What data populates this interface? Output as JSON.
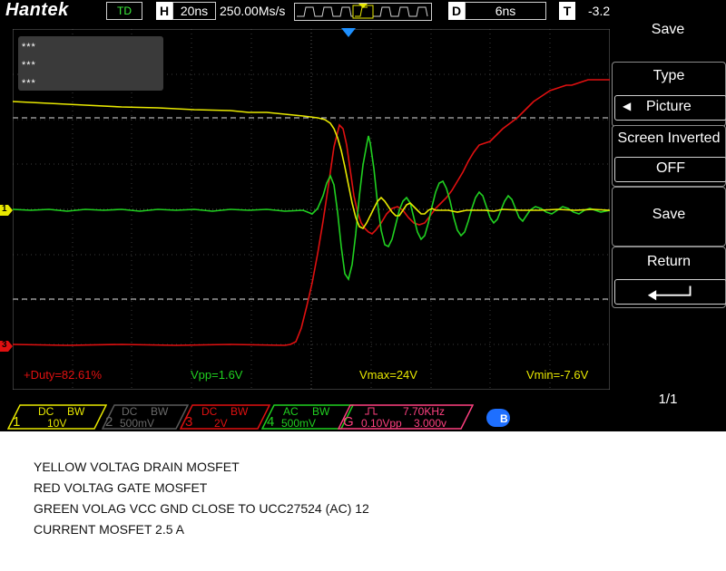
{
  "topbar": {
    "brand": "Hantek",
    "mode": "TD",
    "h_key": "H",
    "h_value": "20ns",
    "sample_rate": "250.00Ms/s",
    "d_key": "D",
    "d_value": "6ns",
    "t_key": "T",
    "t_value": "-3.2"
  },
  "info_box": [
    "***",
    "***",
    "***"
  ],
  "markers": {
    "ch1": "1",
    "ch3": "3"
  },
  "measurements": {
    "duty": "+Duty=82.61%",
    "vpp": "Vpp=1.6V",
    "vmax": "Vmax=24V",
    "vmin": "Vmin=-7.6V"
  },
  "menu": {
    "title": "Save",
    "type_label": "Type",
    "type_value": "Picture",
    "screen_inverted_label": "Screen Inverted",
    "screen_inverted_value": "OFF",
    "save_label": "Save",
    "return_label": "Return",
    "page": "1/1"
  },
  "channels": [
    {
      "num": "1",
      "coupling": "DC",
      "bw": "BW",
      "scale": "10V",
      "color": "#e8e800"
    },
    {
      "num": "2",
      "coupling": "DC",
      "bw": "BW",
      "scale": "500mV",
      "color": "#6a6a6a"
    },
    {
      "num": "3",
      "coupling": "DC",
      "bw": "BW",
      "scale": "2V",
      "color": "#e01010"
    },
    {
      "num": "4",
      "coupling": "AC",
      "bw": "BW",
      "scale": "500mV",
      "color": "#20d020"
    },
    {
      "num": "G",
      "freq": "7.70KHz",
      "amp": "0.10Vpp",
      "offset": "3.000v",
      "color": "#ff4080"
    }
  ],
  "caption": [
    "YELLOW VOLTAG DRAIN MOSFET",
    "RED VOLTAG GATE MOSFET",
    "GREEN VOLAG VCC GND CLOSE TO UCC27524 (AC) 12",
    "CURRENT MOSFET 2.5 A"
  ],
  "colors": {
    "ch1": "#e8e800",
    "ch3": "#e01010",
    "ch4": "#20d020",
    "gen": "#ff4080",
    "trigger_marker": "#1e90ff"
  }
}
